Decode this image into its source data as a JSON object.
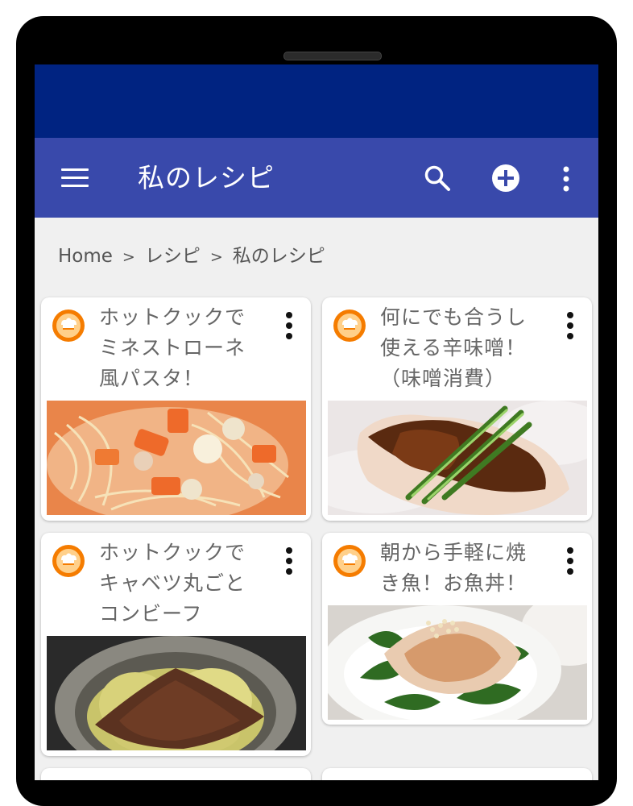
{
  "app_bar": {
    "title": "私のレシピ",
    "icons": [
      "menu-icon",
      "search-icon",
      "add-circle-icon",
      "more-vert-icon"
    ]
  },
  "breadcrumb": {
    "items": [
      "Home",
      "レシピ",
      "私のレシピ"
    ],
    "separator": ">"
  },
  "recipes": [
    {
      "title": "ホットクックでミネストローネ風パスタ！",
      "image": "pasta-photo"
    },
    {
      "title": "何にでも合うし使える辛味噌！（味噌消費）",
      "image": "chicken-miso-photo"
    },
    {
      "title": "ホットクックでキャベツ丸ごとコンビーフ",
      "image": "cabbage-cornedbeef-photo"
    },
    {
      "title": "朝から手軽に焼き魚！お魚丼！",
      "image": "fish-donburi-photo"
    }
  ],
  "colors": {
    "status_bar": "#002381",
    "app_bar": "#3949ab",
    "background": "#f0f0f0",
    "avatar": "#f57c00"
  }
}
